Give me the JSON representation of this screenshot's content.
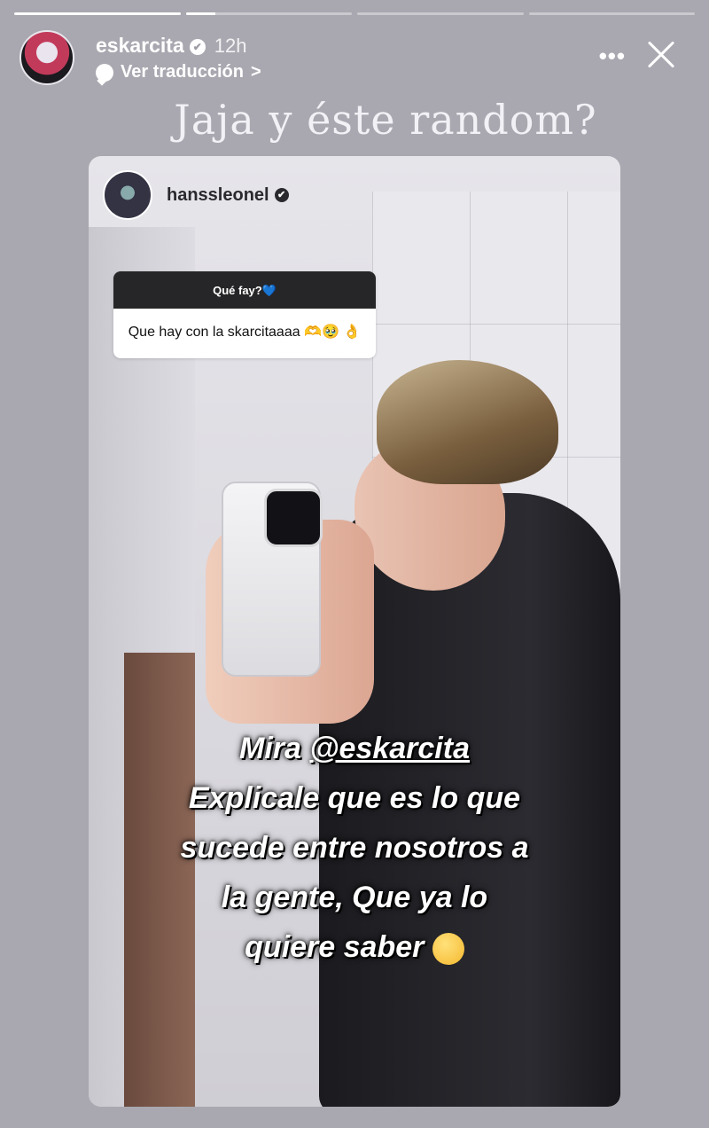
{
  "progress": [
    {
      "fill": 1.0
    },
    {
      "fill": 0.18
    },
    {
      "fill": 0.0
    },
    {
      "fill": 0.0
    }
  ],
  "header": {
    "username": "eskarcita",
    "verified_icon": "✔",
    "time": "12h",
    "translate_label": "Ver traducción",
    "translate_chevron": ">",
    "more": "•••"
  },
  "caption": "Jaja y éste random?",
  "shared_story": {
    "username": "hanssleonel",
    "verified_icon": "✔",
    "question": {
      "prompt": "Qué fay?💙",
      "answer": "Que hay con la skarcitaaaa 🫶🥹 👌"
    },
    "overlay": {
      "line1_prefix": "Mira ",
      "mention": "@eskarcita",
      "line2": "Explicale que es lo que",
      "line3": "sucede entre nosotros a",
      "line4": "la gente, Que ya lo",
      "line5": "quiere saber"
    }
  },
  "colors": {
    "background": "#a9a8b0",
    "progress_fill": "#ffffff"
  }
}
